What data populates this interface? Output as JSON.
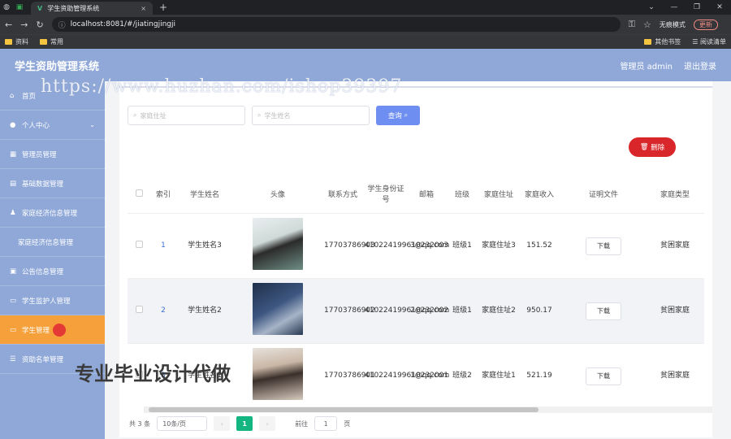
{
  "browser": {
    "tab_title": "学生资助管理系统",
    "tab_close": "×",
    "new_tab": "+",
    "url": "localhost:8081/#/jiatingjingji",
    "incognito_label": "无痕模式",
    "update_label": "更新",
    "bookmarks": [
      "资料",
      "常用"
    ],
    "bookmarks_right": [
      "其他书签",
      "阅读清单"
    ]
  },
  "app": {
    "title": "学生资助管理系统",
    "user_label": "管理员 admin",
    "logout_label": "退出登录"
  },
  "sidebar": {
    "items": [
      {
        "label": "首页",
        "icon": "home-icon"
      },
      {
        "label": "个人中心",
        "icon": "user-icon",
        "chevron": "⌄"
      },
      {
        "label": "管理员管理",
        "icon": "admin-icon"
      },
      {
        "label": "基础数据管理",
        "icon": "data-icon"
      },
      {
        "label": "家庭经济信息管理",
        "icon": "person-icon"
      },
      {
        "label": "家庭经济信息管理",
        "sub": true
      },
      {
        "label": "公告信息管理",
        "icon": "notice-icon"
      },
      {
        "label": "学生监护人管理",
        "icon": "guardian-icon"
      },
      {
        "label": "学生管理",
        "icon": "student-icon",
        "active": true
      },
      {
        "label": "资助名单管理",
        "icon": "list-icon"
      }
    ]
  },
  "search": {
    "placeholder_address": "家庭住址",
    "placeholder_name": "学生姓名",
    "query_label": "查询",
    "delete_label": "删除"
  },
  "table": {
    "headers": [
      "索引",
      "学生姓名",
      "头像",
      "联系方式",
      "学生身份证号",
      "邮箱",
      "班级",
      "家庭住址",
      "家庭收入",
      "证明文件",
      "家庭类型"
    ],
    "rows": [
      {
        "index": "1",
        "name": "学生姓名3",
        "phone": "17703786903",
        "idcard": "410224199610232003",
        "email": "3@qq.com",
        "class": "班级1",
        "address": "家庭住址3",
        "income": "151.52",
        "download": "下载",
        "family_type": "贫困家庭"
      },
      {
        "index": "2",
        "name": "学生姓名2",
        "phone": "17703786902",
        "idcard": "410224199610232002",
        "email": "2@qq.com",
        "class": "班级1",
        "address": "家庭住址2",
        "income": "950.17",
        "download": "下载",
        "family_type": "贫困家庭"
      },
      {
        "index": "3",
        "name": "学生姓名1",
        "phone": "17703786901",
        "idcard": "410224199610232001",
        "email": "1@qq.com",
        "class": "班级2",
        "address": "家庭住址1",
        "income": "521.19",
        "download": "下载",
        "family_type": "贫困家庭"
      }
    ]
  },
  "pager": {
    "total": "共 3 条",
    "page_size": "10条/页",
    "current": "1",
    "goto_label": "前往",
    "goto_value": "1",
    "page_unit": "页",
    "prev": "‹",
    "next": "›"
  },
  "watermarks": {
    "url_text": "https://www.huzhan.com/ishop39397",
    "promo_text": "专业毕业设计代做"
  },
  "colors": {
    "sidebar": "#8fa8d8",
    "active": "#f5a03a",
    "query_button": "#6e8ef1",
    "delete_button": "#d9262a",
    "pager_current": "#13b680"
  }
}
